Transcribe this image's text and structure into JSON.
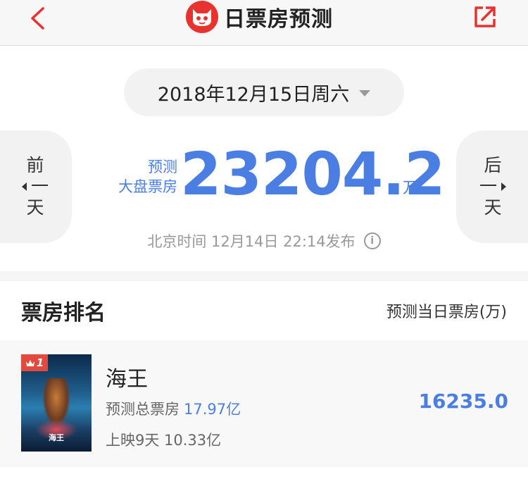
{
  "header": {
    "title": "日票房预测"
  },
  "colors": {
    "accent_blue": "#4a7ee3",
    "brand_red": "#e8322f"
  },
  "forecast": {
    "date": "2018年12月15日周六",
    "label_line1": "预测",
    "label_line2": "大盘票房",
    "value": "23204.2",
    "unit": "万",
    "prev_chars": [
      "前",
      "一",
      "天"
    ],
    "next_chars": [
      "后",
      "一",
      "天"
    ],
    "publish_note": "北京时间 12月14日 22:14发布"
  },
  "ranking": {
    "title": "票房排名",
    "column_label": "预测当日票房(万)",
    "movies": [
      {
        "rank": "1",
        "name": "海王",
        "total_label": "预测总票房",
        "total_value": "17.97亿",
        "released": "上映9天 10.33亿",
        "forecast": "16235.0",
        "poster_title": "海王"
      }
    ]
  }
}
